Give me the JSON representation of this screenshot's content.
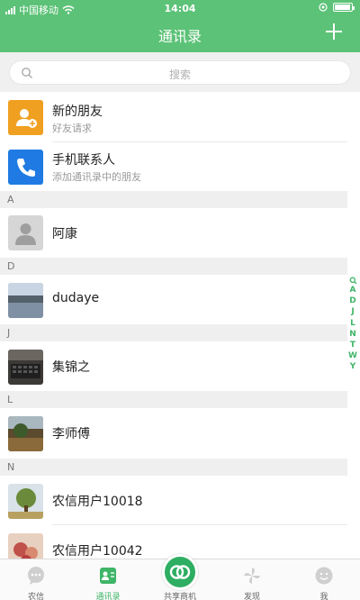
{
  "status_bar": {
    "carrier": "中国移动",
    "time": "14:04"
  },
  "header": {
    "title": "通讯录",
    "add_icon": "plus-icon"
  },
  "search": {
    "placeholder": "搜索"
  },
  "special": [
    {
      "title": "新的朋友",
      "subtitle": "好友请求",
      "icon": "add-friend-icon",
      "color": "#f0a020"
    },
    {
      "title": "手机联系人",
      "subtitle": "添加通讯录中的朋友",
      "icon": "phone-icon",
      "color": "#1f7be3"
    }
  ],
  "sections": [
    {
      "letter": "A",
      "contacts": [
        {
          "name": "阿康"
        }
      ]
    },
    {
      "letter": "D",
      "contacts": [
        {
          "name": "dudaye"
        }
      ]
    },
    {
      "letter": "J",
      "contacts": [
        {
          "name": "集锦之"
        }
      ]
    },
    {
      "letter": "L",
      "contacts": [
        {
          "name": "李师傅"
        }
      ]
    },
    {
      "letter": "N",
      "contacts": [
        {
          "name": "农信用户10018"
        },
        {
          "name": "农信用户10042"
        }
      ]
    }
  ],
  "index_letters": [
    "Q",
    "A",
    "D",
    "J",
    "L",
    "N",
    "T",
    "W",
    "Y"
  ],
  "tabbar": [
    {
      "label": "农信",
      "icon": "chat-bubble-icon",
      "active": false
    },
    {
      "label": "通讯录",
      "icon": "contacts-icon",
      "active": true
    },
    {
      "label": "共享商机",
      "icon": "share-opportunity-icon",
      "active": false
    },
    {
      "label": "发现",
      "icon": "pinwheel-icon",
      "active": false
    },
    {
      "label": "我",
      "icon": "smiley-icon",
      "active": false
    }
  ],
  "colors": {
    "brand_green": "#5cc277",
    "accent_green": "#3fb567",
    "index_green": "#2eae63"
  }
}
